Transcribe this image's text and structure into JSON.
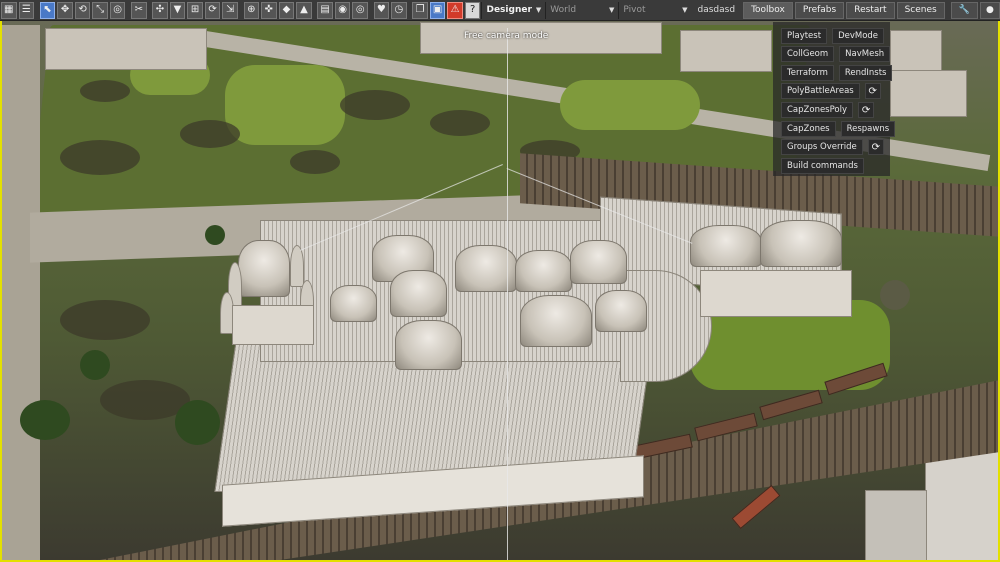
{
  "toolbar": {
    "mode": "Designer",
    "world_placeholder": "World",
    "pivot_label": "Pivot",
    "username": "dasdasd",
    "menu": {
      "toolbox": "Toolbox",
      "prefabs": "Prefabs",
      "restart": "Restart",
      "scenes": "Scenes"
    }
  },
  "viewport": {
    "camera_mode": "Free camera mode"
  },
  "toolbox": {
    "playtest": "Playtest",
    "devmode": "DevMode",
    "collgeom": "CollGeom",
    "navmesh": "NavMesh",
    "terraform": "Terraform",
    "rendinsts": "RendInsts",
    "polybattleareas": "PolyBattleAreas",
    "capzonespoly": "CapZonesPoly",
    "capzones": "CapZones",
    "respawns": "Respawns",
    "groups_override": "Groups Override",
    "build_commands": "Build commands",
    "refresh_glyph": "⟳"
  },
  "icons": {
    "refresh": "refresh-icon",
    "wrench": "wrench-icon",
    "help": "help-icon",
    "warning": "warning-icon"
  },
  "colors": {
    "toolbar_bg": "#3a3a3a",
    "active_blue": "#4a79c7",
    "warning_red": "#d23b2a",
    "frame_yellow": "#e3e000"
  }
}
